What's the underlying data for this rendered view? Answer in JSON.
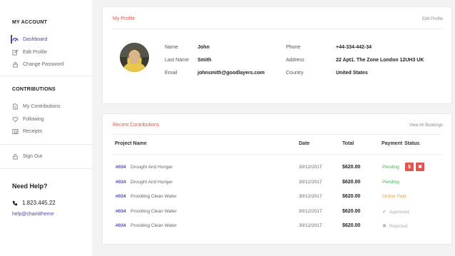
{
  "sidebar": {
    "account_heading": "MY ACCOUNT",
    "account_items": [
      {
        "label": "Dashboard",
        "icon": "dashboard-icon"
      },
      {
        "label": "Edit Profile",
        "icon": "edit-icon"
      },
      {
        "label": "Change Password",
        "icon": "lock-icon"
      }
    ],
    "contrib_heading": "CONTRIBUTIONS",
    "contrib_items": [
      {
        "label": "My Contributions",
        "icon": "document-icon"
      },
      {
        "label": "Following",
        "icon": "heart-icon"
      },
      {
        "label": "Receipts",
        "icon": "receipt-icon"
      }
    ],
    "signout_label": "Sign Out",
    "help_title": "Need Help?",
    "help_phone": "1.823.445.22",
    "help_email": "help@charititheme"
  },
  "profile": {
    "title": "My Profile",
    "edit_link": "Edit Profile",
    "fields": {
      "name_label": "Name",
      "name": "John",
      "lastname_label": "Last Name",
      "lastname": "Smith",
      "email_label": "Email",
      "email": "johnsmith@goodlayers.com",
      "phone_label": "Phone",
      "phone": "+44-334-442-34",
      "address_label": "Address",
      "address": "22 Apt1. The Zone London 12UH3 UK",
      "country_label": "Country",
      "country": "United States"
    }
  },
  "contributions": {
    "title": "Recent Contributions",
    "view_all": "View All Bookings",
    "headers": {
      "project": "Project Name",
      "date": "Date",
      "total": "Total",
      "payment": "Payment",
      "status": "Status"
    },
    "rows": [
      {
        "id": "#034",
        "name": "Drought And Hunger",
        "date": "30/12/2017",
        "total": "$620.00",
        "status": "Pending",
        "status_type": "pending",
        "actions": true
      },
      {
        "id": "#034",
        "name": "Drought And Hunger",
        "date": "30/12/2017",
        "total": "$620.00",
        "status": "Pending",
        "status_type": "pending",
        "actions": false
      },
      {
        "id": "#034",
        "name": "Providing Clean Water",
        "date": "30/12/2017",
        "total": "$620.00",
        "status": "Online Paid",
        "status_type": "online",
        "actions": false
      },
      {
        "id": "#034",
        "name": "Providing Clean Water",
        "date": "30/12/2017",
        "total": "$620.00",
        "status": "Approved",
        "status_type": "approved",
        "actions": false
      },
      {
        "id": "#034",
        "name": "Providing Clean Water",
        "date": "30/12/2017",
        "total": "$620.00",
        "status": "Rejected",
        "status_type": "rejected",
        "actions": false
      }
    ],
    "pay_button": "$",
    "cancel_button": "✖"
  },
  "colors": {
    "accent": "#4a4aa8",
    "red": "#e2534a",
    "green": "#4caf50",
    "orange": "#e6a040"
  }
}
